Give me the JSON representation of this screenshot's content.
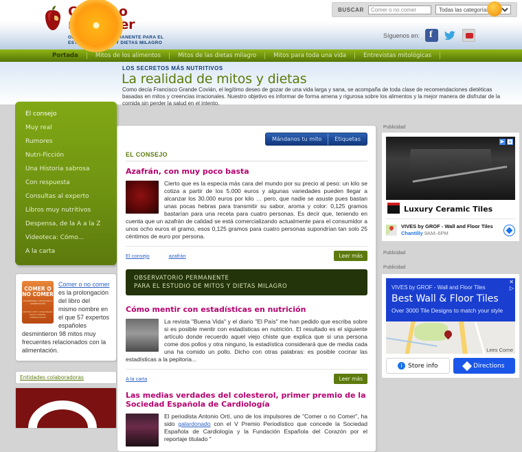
{
  "header": {
    "brand_line1": "Comer o",
    "brand_line2": "no comer",
    "brand_sub_line1": "OBSERVATORIO PERMANENTE PARA EL",
    "brand_sub_line2": "ESTUDIO DE MITOS Y DIETAS MILAGRO",
    "search_label": "BUSCAR",
    "search_value": "Comer o no comer",
    "search_category": "Todas las categorías",
    "follow_label": "Síguenos en:"
  },
  "nav": {
    "items": [
      {
        "label": "Portada",
        "active": true
      },
      {
        "label": "Mitos de los alimentos",
        "active": false
      },
      {
        "label": "Mitos de las dietas milagro",
        "active": false
      },
      {
        "label": "Mitos para toda una vida",
        "active": false
      },
      {
        "label": "Entrevistas mitológicas",
        "active": false
      }
    ]
  },
  "hero": {
    "kicker": "LOS SECRETOS MÁS NUTRITIVOS",
    "title": "La realidad de mitos y dietas",
    "description": "Como decía Francisco Grande Covián, el legítimo deseo de gozar de una vida larga y sana, se acompaña de toda clase de recomendaciones dietéticas basadas en mitos y creencias irracionales. Nuestro objetivo es informar de forma amena y rigurosa sobre los alimentos y la mejor manera de disfrutar de la comida sin perder la salud en el intento."
  },
  "sidebar": {
    "menu": [
      {
        "label": "El consejo"
      },
      {
        "label": "Muy real"
      },
      {
        "label": "Rumores"
      },
      {
        "label": "Nutri-Ficción"
      },
      {
        "label": "Una Historia sabrosa"
      },
      {
        "label": "Con respuesta"
      },
      {
        "label": "Consultas al experto"
      },
      {
        "label": "Libros muy nutritivos"
      },
      {
        "label": "Despensa, de la A a la Z"
      },
      {
        "label": "Videoteca: Cómo..."
      },
      {
        "label": "A la carta"
      }
    ],
    "book": {
      "cover_title": "COMER O NO COMER",
      "cover_sub": "FALSEDADES Y MITOS DE LA ALIMENTACIÓN",
      "cover_authors": "ANTONIO ORTÍ / JOSE MIGUEL MULET, MANUEL TORREIGLESIAS",
      "link_text": "Comer o no comer",
      "text": " es la prolongación del libro del mismo nombre en el que 57 expertos españoles desmintieron 98 mitos muy frecuentes relacionados con la alimentación."
    },
    "entities_title": "Entidades colaboradoras"
  },
  "main": {
    "tabs": [
      {
        "label": "Mándanos tu mito"
      },
      {
        "label": "Etiquetas"
      }
    ],
    "section_heading": "EL CONSEJO",
    "articles": [
      {
        "title": "Azafrán, con muy poco basta",
        "body": "Cierto que es la especia más cara del mundo por su precio al peso: un kilo se cotiza a partir de los 5.000 euros y algunas variedades pueden llegar a alcanzar los 30.000 euros por kilo … pero, que nadie se asuste pues bastan unas pocas hebras para transmitir su sabor, aroma y color: 0,125 gramos bastarían para una receta para cuatro personas. Es decir que, teniendo en cuenta que un azafrán de calidad se está comercializando actualmente para el consumidor a unos ocho euros el gramo, esos 0,125 gramos para cuatro personas supondrían tan solo 25 céntimos de euro por persona.",
        "tags": [
          "El consejo",
          "azafrán"
        ],
        "more_label": "Leer más"
      },
      {
        "title": "Cómo mentir con estadísticas en nutrición",
        "body": "La revista \"Buena Vida\" y el diario \"El País\" me han pedido que escriba sobre si es posible mentir con estadísticas en nutrición. El resultado es el siguiente artículo donde recuerdo aquel viejo chiste que explica que si una persona come dos pollos y otra ninguno, la estadística considerará que de media cada una ha comido un pollo. Dicho con otras palabras: es posible cocinar las estadísticas a la pepitoria...",
        "tags": [
          "A la carta"
        ],
        "more_label": "Leer más"
      },
      {
        "title": "Las medias verdades del colesterol, primer premio de la Sociedad Española de Cardiología",
        "body_pre": "El periodista Antonio Ortí, uno de los impulsores de \"Comer o no Comer\", ha sido ",
        "body_link": "galardonado",
        "body_post": " con el V Premio Periodístico que concede la Sociedad Española de Cardiología y la Fundación Española del Corazón por el reportaje titulado \""
      }
    ],
    "banner_line1": "OBSERVATORIO PERMANENTE",
    "banner_line2": "PARA EL ESTUDIO DE MITOS Y DIETAS MILAGRO"
  },
  "ads": {
    "label1": "Publicidad",
    "label2": "Publicidad",
    "label3": "Publicidad",
    "ad1": {
      "title": "Luxury Ceramic Tiles",
      "advertiser": "VIVES by GROF - Wall and Floor Tiles",
      "location": "Chantilly",
      "hours": "9AM–6PM"
    },
    "ad2": {
      "kicker": "VIVES by GROF - Wall and Floor Tiles",
      "headline": "Best Wall & Floor Tiles",
      "sub": "Over 3000 Tile Designs to match your style",
      "map_label": "Lees Corne",
      "btn_info": "Store info",
      "btn_directions": "Directions"
    }
  },
  "colors": {
    "green": "#5c7a0e",
    "magenta": "#b4006e",
    "brand_red": "#9b0f0f",
    "link_blue": "#2c61c4"
  }
}
